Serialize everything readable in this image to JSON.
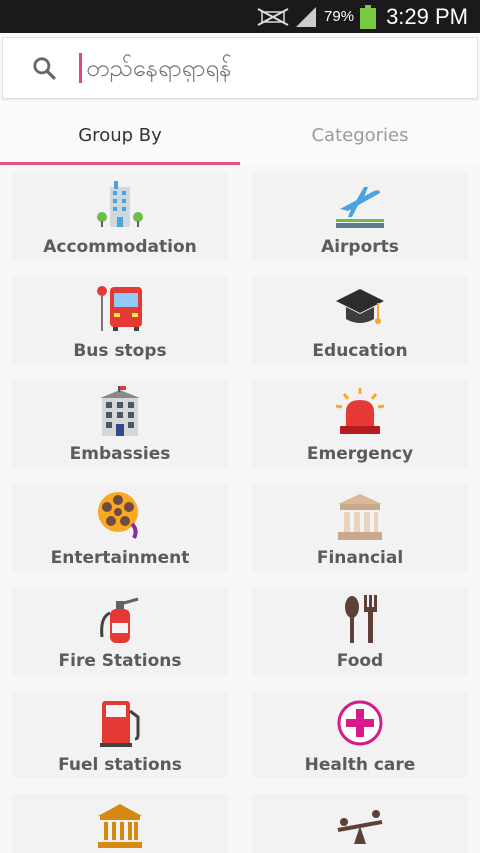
{
  "status": {
    "battery": "79%",
    "time": "3:29 PM"
  },
  "search": {
    "placeholder": "တည်နေရာရှာရန်"
  },
  "tabs": [
    {
      "label": "Group By"
    },
    {
      "label": "Categories"
    }
  ],
  "categories": [
    {
      "label": "Accommodation",
      "icon": "hotel-icon"
    },
    {
      "label": "Airports",
      "icon": "airplane-icon"
    },
    {
      "label": "Bus stops",
      "icon": "bus-icon"
    },
    {
      "label": "Education",
      "icon": "graduation-cap-icon"
    },
    {
      "label": "Embassies",
      "icon": "embassy-building-icon"
    },
    {
      "label": "Emergency",
      "icon": "siren-icon"
    },
    {
      "label": "Entertainment",
      "icon": "film-reel-icon"
    },
    {
      "label": "Financial",
      "icon": "bank-icon"
    },
    {
      "label": "Fire Stations",
      "icon": "fire-extinguisher-icon"
    },
    {
      "label": "Food",
      "icon": "fork-spoon-icon"
    },
    {
      "label": "Fuel stations",
      "icon": "fuel-pump-icon"
    },
    {
      "label": "Health care",
      "icon": "medical-cross-icon"
    },
    {
      "label": "",
      "icon": "museum-icon"
    },
    {
      "label": "",
      "icon": "seesaw-icon"
    }
  ]
}
